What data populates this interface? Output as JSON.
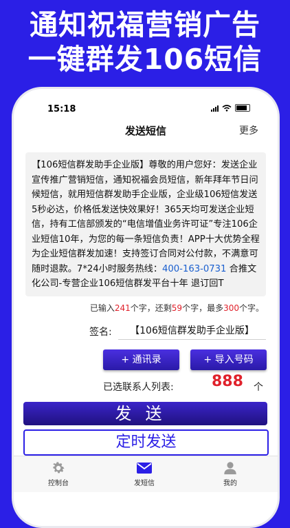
{
  "promo": {
    "line1": "通知祝福营销广告",
    "line2": "一键群发106短信"
  },
  "status_bar": {
    "time": "15:18"
  },
  "nav": {
    "title": "发送短信",
    "more": "更多"
  },
  "message": {
    "text_before": "【106短信群发助手企业版】尊敬的用户您好：发送企业宣传推广营销短信，通知祝福会员短信，新年拜年节日问候短信，就用短信群发助手企业版，企业级106短信发送5秒必达，价格低发送快效果好！365天均可发送企业短信，持有工信部颁发的“电信增值业务许可证”专注106企业短信10年，为您的每一条短信负责！APP十大优势全程为企业短信群发加速！支持签订合同对公付款，不满意可随时退款。7*24小时服务热线：",
    "phone": "400-163-0731",
    "text_after": " 合推文化公司-专营企业106短信群发平台十年 退订回T"
  },
  "counter": {
    "p1": "已输入",
    "typed": "241",
    "p2": "个字，还剩",
    "remaining": "59",
    "p3": "个字，最多",
    "max": "300",
    "p4": "个字。"
  },
  "signature": {
    "label": "签名:",
    "value": "【106短信群发助手企业版】"
  },
  "buttons": {
    "contacts": "+ 通讯录",
    "import": "+ 导入号码",
    "send": "发送",
    "timed_send": "定时发送"
  },
  "selected": {
    "label": "已选联系人列表:",
    "count": "888",
    "unit": "个"
  },
  "tabs": [
    {
      "label": "控制台",
      "icon": "gear-icon"
    },
    {
      "label": "发短信",
      "icon": "mail-icon",
      "active": true
    },
    {
      "label": "我的",
      "icon": "person-icon"
    }
  ],
  "colors": {
    "brand": "#2b1fe6",
    "accent_red": "#e0212b",
    "link_blue": "#1a5fcf"
  }
}
